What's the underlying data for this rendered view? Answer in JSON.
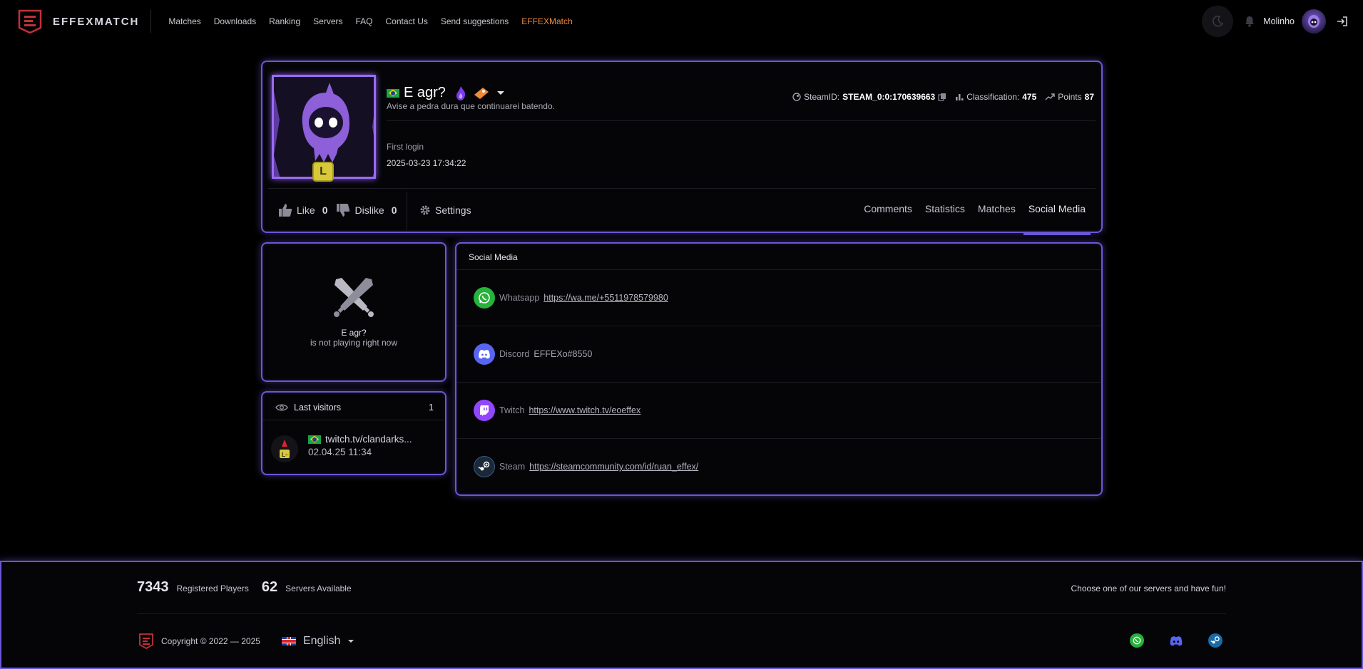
{
  "brand": {
    "name": "EFFEXMATCH"
  },
  "nav": {
    "links": [
      "Matches",
      "Downloads",
      "Ranking",
      "Servers",
      "FAQ",
      "Contact Us",
      "Send suggestions",
      "EFFEXMatch"
    ]
  },
  "user": {
    "name": "Molinho"
  },
  "profile": {
    "name": "E agr?",
    "status": "Avise a pedra dura que continuarei batendo.",
    "rank_letter": "L",
    "steamid_label": "SteamID:",
    "steamid": "STEAM_0:0:170639663",
    "classification_label": "Classification:",
    "classification": "475",
    "points_label": "Points",
    "points": "87",
    "first_login_label": "First login",
    "first_login": "2025-03-23 17:34:22",
    "like_label": "Like",
    "like_count": "0",
    "dislike_label": "Dislike",
    "dislike_count": "0",
    "settings_label": "Settings",
    "tabs": [
      "Comments",
      "Statistics",
      "Matches",
      "Social Media"
    ],
    "active_tab": "Social Media"
  },
  "now_playing": {
    "name": "E agr?",
    "status": "is not playing right now"
  },
  "visitors": {
    "title": "Last visitors",
    "count": "1",
    "items": [
      {
        "name": "twitch.tv/clandarks...",
        "date": "02.04.25 11:34"
      }
    ]
  },
  "social_media": {
    "title": "Social Media",
    "items": [
      {
        "platform": "Whatsapp",
        "value": "https://wa.me/+5511978579980",
        "icon": "whatsapp-icon",
        "color": "#25b33a"
      },
      {
        "platform": "Discord",
        "value": "EFFEXo#8550",
        "icon": "discord-icon",
        "color": "#5865f2"
      },
      {
        "platform": "Twitch",
        "value": "https://www.twitch.tv/eoeffex",
        "icon": "twitch-icon",
        "color": "#9146ff"
      },
      {
        "platform": "Steam",
        "value": "https://steamcommunity.com/id/ruan_effex/",
        "icon": "steam-icon",
        "color": "#1b2838"
      }
    ]
  },
  "footer": {
    "players_count": "7343",
    "players_label": "Registered Players",
    "servers_count": "62",
    "servers_label": "Servers Available",
    "tagline": "Choose one of our servers and have fun!",
    "copyright": "Copyright © 2022 — 2025",
    "language": "English"
  },
  "colors": {
    "accent": "#6d56d8",
    "brand_orange": "#f08a3b",
    "background": "#000000"
  }
}
